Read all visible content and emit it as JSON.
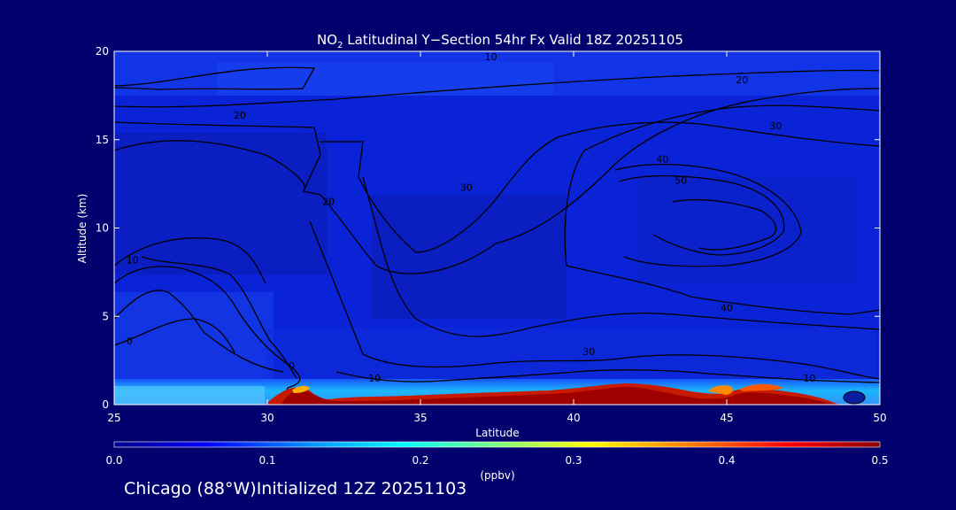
{
  "chart_data": {
    "type": "heatmap",
    "title_prefix": "NO",
    "title_subscript": "2",
    "title_rest": " Latitudinal Y−Section 54hr  Fx Valid 18Z 20251105",
    "xlabel": "Latitude",
    "ylabel": "Altitude (km)",
    "xlim": [
      25,
      50
    ],
    "ylim": [
      0,
      20
    ],
    "x_ticks": [
      25,
      30,
      35,
      40,
      45,
      50
    ],
    "y_ticks": [
      0,
      5,
      10,
      15,
      20
    ],
    "colorbar": {
      "label": "(ppbv)",
      "range": [
        0.0,
        0.5
      ],
      "ticks": [
        "0.0",
        "0.1",
        "0.2",
        "0.3",
        "0.4",
        "0.5"
      ],
      "colors": [
        "#00008b",
        "#0000ff",
        "#0096ff",
        "#00ffff",
        "#7fff7f",
        "#ffff00",
        "#ff7f00",
        "#ff0000",
        "#8b0000"
      ]
    },
    "contour_labels": [
      {
        "text": "10",
        "lat": 37.3,
        "alt": 19.5
      },
      {
        "text": "20",
        "lat": 45.5,
        "alt": 18.2
      },
      {
        "text": "20",
        "lat": 29.1,
        "alt": 16.2
      },
      {
        "text": "30",
        "lat": 46.6,
        "alt": 15.6
      },
      {
        "text": "40",
        "lat": 42.9,
        "alt": 13.7
      },
      {
        "text": "50",
        "lat": 43.5,
        "alt": 12.5
      },
      {
        "text": "30",
        "lat": 36.5,
        "alt": 12.1
      },
      {
        "text": "20",
        "lat": 32.0,
        "alt": 11.3
      },
      {
        "text": "10",
        "lat": 25.6,
        "alt": 8.0
      },
      {
        "text": "40",
        "lat": 45.0,
        "alt": 5.3
      },
      {
        "text": "0",
        "lat": 25.5,
        "alt": 3.4
      },
      {
        "text": "30",
        "lat": 40.5,
        "alt": 2.8
      },
      {
        "text": "0",
        "lat": 30.8,
        "alt": 2.0
      },
      {
        "text": "10",
        "lat": 33.5,
        "alt": 1.3
      },
      {
        "text": "10",
        "lat": 47.7,
        "alt": 1.3
      }
    ]
  },
  "footer_text": "Chicago (88°W)Initialized 12Z 20251103"
}
